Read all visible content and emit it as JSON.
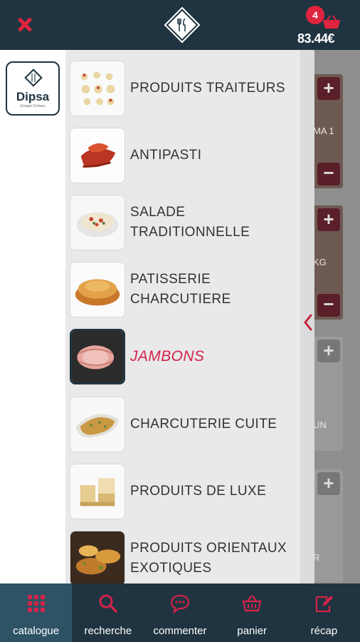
{
  "header": {
    "cart_count": "4",
    "cart_total": "83.44€"
  },
  "brand": {
    "name": "Dipsa",
    "tagline": "Groupe Cortozo"
  },
  "categories": [
    {
      "label": "PRODUITS TRAITEURS",
      "active": false
    },
    {
      "label": "ANTIPASTI",
      "active": false
    },
    {
      "label": "SALADE TRADITIONNELLE",
      "active": false
    },
    {
      "label": "PATISSERIE CHARCUTIERE",
      "active": false
    },
    {
      "label": "JAMBONS",
      "active": true
    },
    {
      "label": "CHARCUTERIE CUITE",
      "active": false
    },
    {
      "label": "PRODUITS DE LUXE",
      "active": false
    },
    {
      "label": "PRODUITS ORIENTAUX EXOTIQUES",
      "active": false
    }
  ],
  "background_cards": [
    {
      "code": "MA 1"
    },
    {
      "code": "KG"
    },
    {
      "code": "UN"
    },
    {
      "code": "R"
    }
  ],
  "bottom_nav": [
    {
      "label": "catalogue",
      "icon": "grid-icon",
      "active": true
    },
    {
      "label": "recherche",
      "icon": "search-icon",
      "active": false
    },
    {
      "label": "commenter",
      "icon": "comment-icon",
      "active": false
    },
    {
      "label": "panier",
      "icon": "basket-icon",
      "active": false
    },
    {
      "label": "récap",
      "icon": "edit-icon",
      "active": false
    }
  ],
  "colors": {
    "primary": "#1f3440",
    "accent": "#e0243f",
    "active_label": "#d4234a"
  }
}
